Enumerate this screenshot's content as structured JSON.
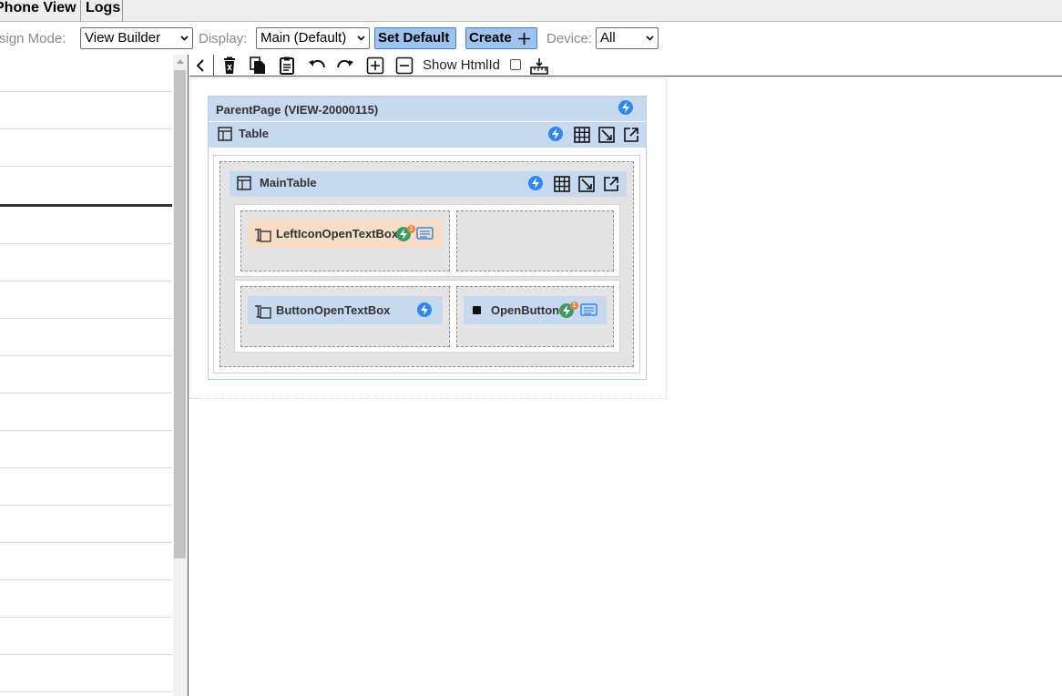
{
  "tabs": {
    "phone_view": "Phone View",
    "logs": "Logs"
  },
  "toolbar": {
    "design_mode_label": "sign Mode:",
    "design_mode_value": "View Builder",
    "display_label": "Display:",
    "display_value": "Main (Default)",
    "set_default_label": "Set Default",
    "create_label": "Create",
    "device_label": "Device:",
    "device_value": "All"
  },
  "canvas_toolbar": {
    "show_htmlid_label": "Show HtmlId",
    "show_htmlid_checked": false,
    "icons": [
      "collapse-left-icon",
      "delete-icon",
      "copy-icon",
      "paste-icon",
      "undo-icon",
      "redo-icon",
      "expand-all-icon",
      "collapse-all-icon",
      "ruler-icon"
    ]
  },
  "canvas": {
    "parent_page_title": "ParentPage (VIEW-20000115)",
    "table_label": "Table",
    "main_table_label": "MainTable",
    "cells": {
      "left_icon_textbox": "LeftIconOpenTextBox",
      "button_textbox": "ButtonOpenTextBox",
      "open_button": "OpenButton"
    },
    "badge_count": "1"
  },
  "colors": {
    "header_blue": "#c7d9ef",
    "action_blue": "#2f86ee",
    "event_green": "#3f9a62",
    "badge_orange": "#f07f3c",
    "control_orange": "#f7dcc6",
    "button_blue": "#9fc2ef"
  }
}
